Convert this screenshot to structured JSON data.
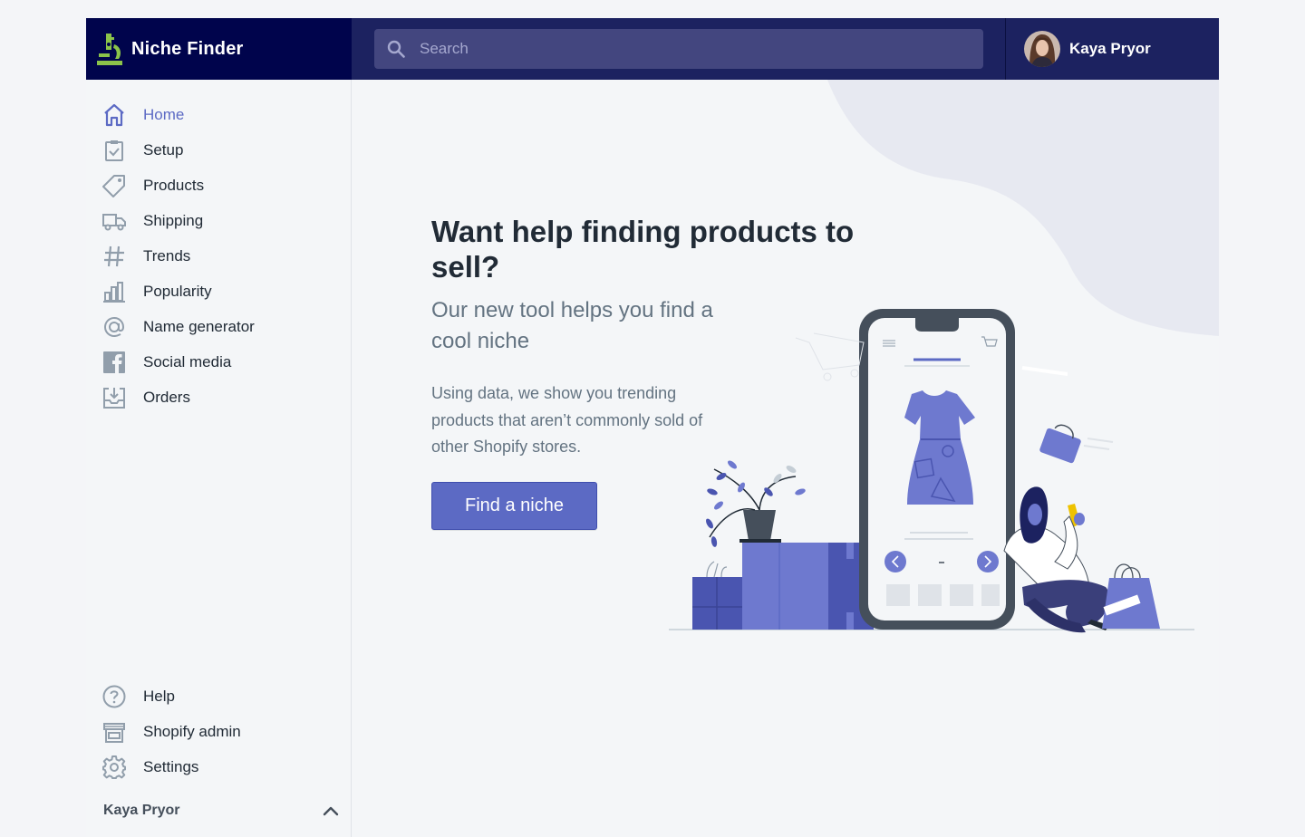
{
  "app": {
    "name": "Niche Finder"
  },
  "search": {
    "placeholder": "Search"
  },
  "user": {
    "name": "Kaya Pryor"
  },
  "sidebar": {
    "items": [
      {
        "label": "Home",
        "icon": "home-icon",
        "active": true
      },
      {
        "label": "Setup",
        "icon": "clipboard-check-icon"
      },
      {
        "label": "Products",
        "icon": "tag-icon"
      },
      {
        "label": "Shipping",
        "icon": "truck-icon"
      },
      {
        "label": "Trends",
        "icon": "hashtag-icon"
      },
      {
        "label": "Popularity",
        "icon": "bar-chart-icon"
      },
      {
        "label": "Name generator",
        "icon": "at-sign-icon"
      },
      {
        "label": "Social media",
        "icon": "facebook-icon"
      },
      {
        "label": "Orders",
        "icon": "inbox-download-icon"
      }
    ],
    "footer_items": [
      {
        "label": "Help",
        "icon": "question-circle-icon"
      },
      {
        "label": "Shopify admin",
        "icon": "store-icon"
      },
      {
        "label": "Settings",
        "icon": "gear-icon"
      }
    ],
    "account_name": "Kaya Pryor",
    "account_icon": "chevron-up-icon"
  },
  "hero": {
    "headline": "Want help finding products to sell?",
    "subheadline": "Our new tool helps you find a cool niche",
    "body": "Using data, we show you trending products that aren’t commonly sold of other Shopify stores.",
    "cta": "Find a niche"
  },
  "colors": {
    "topbar": "#1c2260",
    "brand": "#00044c",
    "accent": "#5c6ac4",
    "text": "#212b36",
    "muted": "#637381",
    "logo": "#8bc34a"
  }
}
